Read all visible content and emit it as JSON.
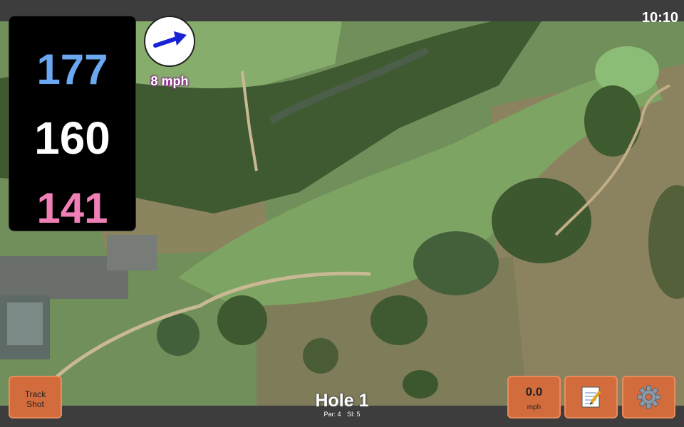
{
  "status_bar": {
    "time": "10:10"
  },
  "yardage": {
    "back": "177",
    "middle": "160",
    "front": "141"
  },
  "wind": {
    "speed_label": "8 mph",
    "direction_icon": "arrow-right-icon"
  },
  "hole": {
    "title": "Hole 1",
    "par_label": "Par: 4",
    "si_label": "SI: 5"
  },
  "buttons": {
    "track_line1": "Track",
    "track_line2": "Shot",
    "speed_value": "0.0",
    "speed_unit": "mph",
    "notes_icon": "notepad-icon",
    "settings_icon": "gear-icon"
  },
  "colors": {
    "back_yardage": "#6aa8f2",
    "middle_yardage": "#ffffff",
    "front_yardage": "#f07fb6",
    "button": "#d36c3c",
    "wind_arrow": "#1a22d6"
  }
}
